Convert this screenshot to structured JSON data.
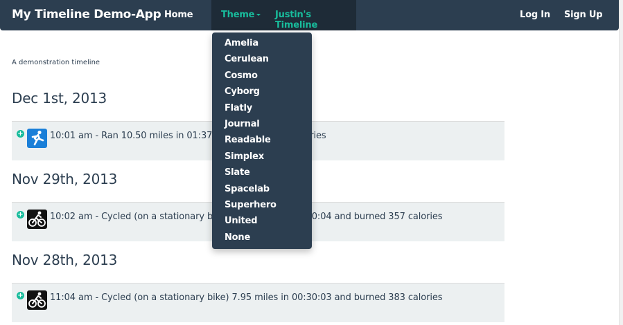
{
  "nav": {
    "brand": "My Timeline Demo-App",
    "home": "Home",
    "theme": "Theme",
    "justin": "Justin's Timeline",
    "login": "Log In",
    "signup": "Sign Up"
  },
  "theme_menu": [
    "Amelia",
    "Cerulean",
    "Cosmo",
    "Cyborg",
    "Flatly",
    "Journal",
    "Readable",
    "Simplex",
    "Slate",
    "Spacelab",
    "Superhero",
    "United",
    "None"
  ],
  "page": {
    "tagline": "A demonstration timeline"
  },
  "timeline": [
    {
      "date": "Dec 1st, 2013",
      "icon": "running-icon",
      "text": "10:01 am - Ran 10.50 miles in 01:37:50 and burned 1 calories"
    },
    {
      "date": "Nov 29th, 2013",
      "icon": "cycling-icon",
      "text": "10:02 am - Cycled (on a stationary bike) 8.14 miles in 00:30:04 and burned 357 calories"
    },
    {
      "date": "Nov 28th, 2013",
      "icon": "cycling-icon",
      "text": "11:04 am - Cycled (on a stationary bike) 7.95 miles in 00:30:03 and burned 383 calories"
    }
  ],
  "colors": {
    "navbar": "#2c3e50",
    "accent": "#18bc9c",
    "entry_bg": "#ecf0f1"
  }
}
